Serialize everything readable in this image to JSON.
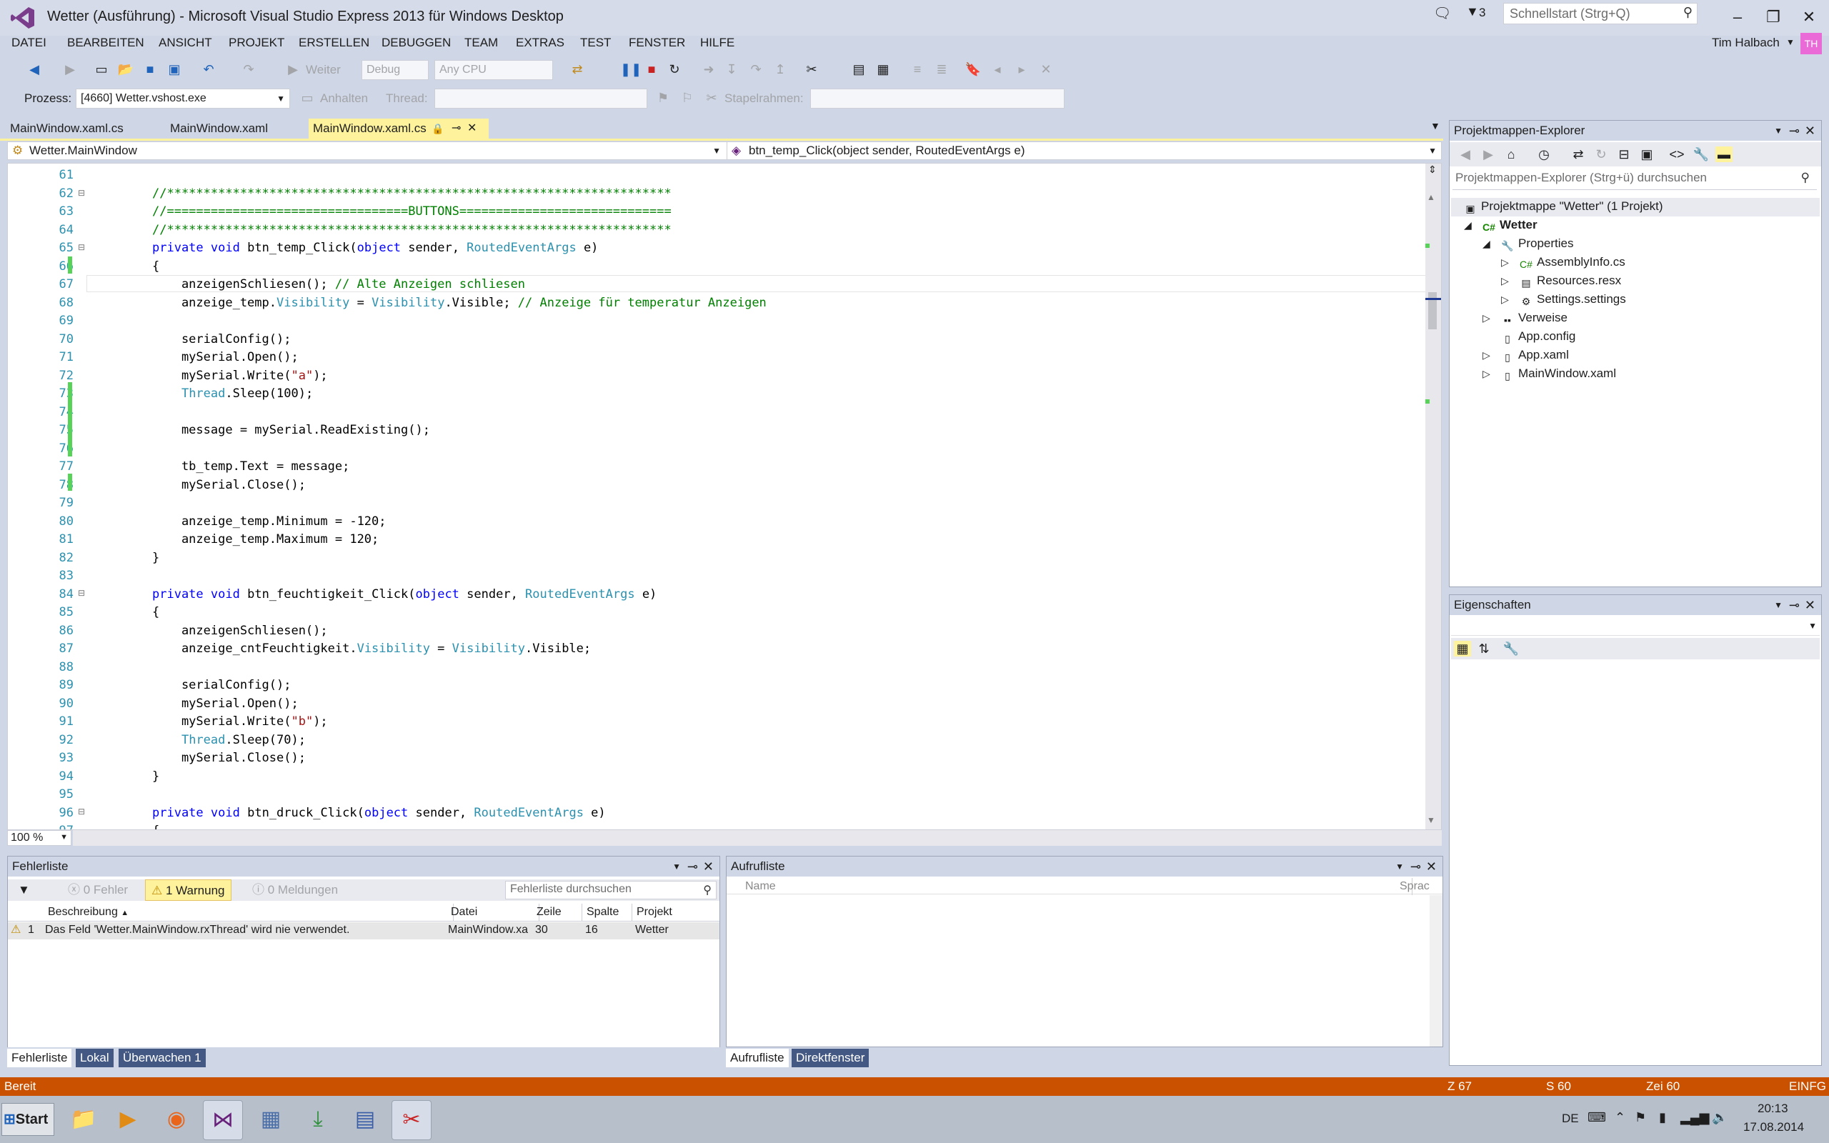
{
  "window": {
    "title": "Wetter (Ausführung) - Microsoft Visual Studio Express 2013 für Windows Desktop",
    "notification_count": "3",
    "quick_launch_placeholder": "Schnellstart (Strg+Q)",
    "user_name": "Tim Halbach",
    "user_initials": "TH"
  },
  "menu": [
    "DATEI",
    "BEARBEITEN",
    "ANSICHT",
    "PROJEKT",
    "ERSTELLEN",
    "DEBUGGEN",
    "TEAM",
    "EXTRAS",
    "TEST",
    "FENSTER",
    "HILFE"
  ],
  "toolbar": {
    "continue_label": "Weiter",
    "config_value": "Debug",
    "platform_value": "Any CPU",
    "process_label": "Prozess:",
    "process_value": "[4660] Wetter.vshost.exe",
    "stop_label": "Anhalten",
    "thread_label": "Thread:",
    "stackframe_label": "Stapelrahmen:"
  },
  "doc_tabs": [
    {
      "label": "MainWindow.xaml.cs",
      "active": false
    },
    {
      "label": "MainWindow.xaml",
      "active": false
    },
    {
      "label": "MainWindow.xaml.cs",
      "active": true
    }
  ],
  "navigation": {
    "type_value": "Wetter.MainWindow",
    "member_value": "btn_temp_Click(object sender, RoutedEventArgs e)"
  },
  "code_lines": [
    {
      "no": "61",
      "text": ""
    },
    {
      "no": "62",
      "text": "//*********************************************************************"
    },
    {
      "no": "63",
      "text": "//=================================BUTTONS============================="
    },
    {
      "no": "64",
      "text": "//*********************************************************************"
    },
    {
      "no": "65",
      "text": "private void btn_temp_Click(object sender, RoutedEventArgs e)"
    },
    {
      "no": "66",
      "text": "{"
    },
    {
      "no": "67",
      "text": "    anzeigenSchliesen(); // Alte Anzeigen schliesen"
    },
    {
      "no": "68",
      "text": "    anzeige_temp.Visibility = Visibility.Visible; // Anzeige für temperatur Anzeigen"
    },
    {
      "no": "69",
      "text": ""
    },
    {
      "no": "70",
      "text": "    serialConfig();"
    },
    {
      "no": "71",
      "text": "    mySerial.Open();"
    },
    {
      "no": "72",
      "text": "    mySerial.Write(\"a\");"
    },
    {
      "no": "73",
      "text": "    Thread.Sleep(100);"
    },
    {
      "no": "74",
      "text": ""
    },
    {
      "no": "75",
      "text": "    message = mySerial.ReadExisting();"
    },
    {
      "no": "76",
      "text": ""
    },
    {
      "no": "77",
      "text": "    tb_temp.Text = message;"
    },
    {
      "no": "78",
      "text": "    mySerial.Close();"
    },
    {
      "no": "79",
      "text": ""
    },
    {
      "no": "80",
      "text": "    anzeige_temp.Minimum = -120;"
    },
    {
      "no": "81",
      "text": "    anzeige_temp.Maximum = 120;"
    },
    {
      "no": "82",
      "text": "}"
    },
    {
      "no": "83",
      "text": ""
    },
    {
      "no": "84",
      "text": "private void btn_feuchtigkeit_Click(object sender, RoutedEventArgs e)"
    },
    {
      "no": "85",
      "text": "{"
    },
    {
      "no": "86",
      "text": "    anzeigenSchliesen();"
    },
    {
      "no": "87",
      "text": "    anzeige_cntFeuchtigkeit.Visibility = Visibility.Visible;"
    },
    {
      "no": "88",
      "text": ""
    },
    {
      "no": "89",
      "text": "    serialConfig();"
    },
    {
      "no": "90",
      "text": "    mySerial.Open();"
    },
    {
      "no": "91",
      "text": "    mySerial.Write(\"b\");"
    },
    {
      "no": "92",
      "text": "    Thread.Sleep(70);"
    },
    {
      "no": "93",
      "text": "    mySerial.Close();"
    },
    {
      "no": "94",
      "text": "}"
    },
    {
      "no": "95",
      "text": ""
    },
    {
      "no": "96",
      "text": "private void btn_druck_Click(object sender, RoutedEventArgs e)"
    },
    {
      "no": "97",
      "text": "{"
    }
  ],
  "zoom": "100 %",
  "solution_explorer": {
    "title": "Projektmappen-Explorer",
    "search_placeholder": "Projektmappen-Explorer (Strg+ü) durchsuchen",
    "items": [
      "Projektmappe \"Wetter\" (1 Projekt)",
      "Wetter",
      "Properties",
      "AssemblyInfo.cs",
      "Resources.resx",
      "Settings.settings",
      "Verweise",
      "App.config",
      "App.xaml",
      "MainWindow.xaml"
    ]
  },
  "properties_panel": {
    "title": "Eigenschaften"
  },
  "error_list": {
    "title": "Fehlerliste",
    "errors_label": "0 Fehler",
    "warnings_label": "1 Warnung",
    "messages_label": "0 Meldungen",
    "search_placeholder": "Fehlerliste durchsuchen",
    "columns": [
      "Beschreibung",
      "Datei",
      "Zeile",
      "Spalte",
      "Projekt"
    ],
    "rows": [
      {
        "index": "1",
        "description": "Das Feld 'Wetter.MainWindow.rxThread' wird nie verwendet.",
        "file": "MainWindow.xa",
        "line": "30",
        "column": "16",
        "project": "Wetter"
      }
    ],
    "tabs": [
      "Fehlerliste",
      "Lokal",
      "Überwachen 1"
    ]
  },
  "call_stack": {
    "title": "Aufrufliste",
    "columns": [
      "Name",
      "Sprac"
    ],
    "tabs": [
      "Aufrufliste",
      "Direktfenster"
    ]
  },
  "status": {
    "text": "Bereit",
    "line": "Z 67",
    "column": "S 60",
    "char": "Zei 60",
    "mode": "EINFG"
  },
  "taskbar": {
    "start_label": "Start",
    "language": "DE",
    "time": "20:13",
    "date": "17.08.2014"
  },
  "colors": {
    "accent": "#ca5100",
    "active_tab": "#fff29d",
    "keyword": "#0000ff",
    "type": "#2b91af",
    "comment": "#008000",
    "string": "#a31515",
    "change_marker": "#57d357"
  }
}
